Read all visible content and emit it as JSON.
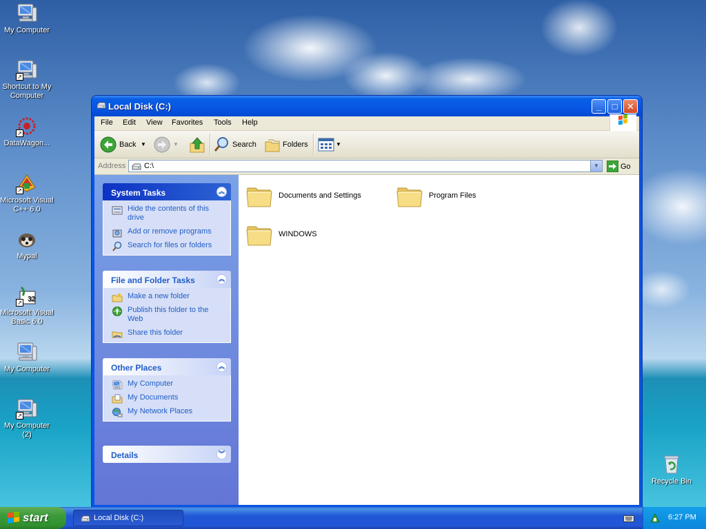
{
  "desktop": {
    "icons": [
      {
        "label": "My Computer",
        "icon": "my-computer-icon"
      },
      {
        "label": "Shortcut to My Computer",
        "icon": "my-computer-icon"
      },
      {
        "label": "DataWagon...",
        "icon": "datawagon-icon"
      },
      {
        "label": "Microsoft Visual C++ 6.0",
        "icon": "visual-cpp-icon"
      },
      {
        "label": "Mypal",
        "icon": "mypal-icon"
      },
      {
        "label": "Microsoft Visual Basic 6.0",
        "icon": "visual-basic-icon"
      },
      {
        "label": "My Computer",
        "icon": "my-computer-icon"
      },
      {
        "label": "My Computer (2)",
        "icon": "my-computer-icon"
      },
      {
        "label": "Recycle Bin",
        "icon": "recycle-bin-icon"
      }
    ]
  },
  "window": {
    "title": "Local Disk (C:)",
    "menu": [
      {
        "label": "File"
      },
      {
        "label": "Edit"
      },
      {
        "label": "View"
      },
      {
        "label": "Favorites"
      },
      {
        "label": "Tools"
      },
      {
        "label": "Help"
      }
    ],
    "toolbar": {
      "back": "Back",
      "search": "Search",
      "folders": "Folders"
    },
    "address": {
      "label": "Address",
      "value": "C:\\",
      "go": "Go"
    },
    "taskpane": {
      "system_tasks": {
        "title": "System Tasks",
        "links": [
          {
            "label": "Hide the contents of this drive",
            "icon": "hide-contents-icon"
          },
          {
            "label": "Add or remove programs",
            "icon": "add-remove-programs-icon"
          },
          {
            "label": "Search for files or folders",
            "icon": "search-icon"
          }
        ]
      },
      "file_folder_tasks": {
        "title": "File and Folder Tasks",
        "links": [
          {
            "label": "Make a new folder",
            "icon": "new-folder-icon"
          },
          {
            "label": "Publish this folder to the Web",
            "icon": "publish-web-icon"
          },
          {
            "label": "Share this folder",
            "icon": "share-folder-icon"
          }
        ]
      },
      "other_places": {
        "title": "Other Places",
        "links": [
          {
            "label": "My Computer",
            "icon": "my-computer-icon"
          },
          {
            "label": "My Documents",
            "icon": "my-documents-icon"
          },
          {
            "label": "My Network Places",
            "icon": "network-places-icon"
          }
        ]
      },
      "details": {
        "title": "Details"
      }
    },
    "folders": [
      {
        "name": "Documents and Settings"
      },
      {
        "name": "Program Files"
      },
      {
        "name": "WINDOWS"
      }
    ]
  },
  "taskbar": {
    "start": "start",
    "tasks": [
      {
        "label": "Local Disk (C:)"
      }
    ],
    "clock": "6:27 PM"
  },
  "colors": {
    "titlebar": "#0a5fe6",
    "taskpane": "#7ba2e7",
    "link": "#215dc6",
    "start": "#3c9a3b"
  }
}
